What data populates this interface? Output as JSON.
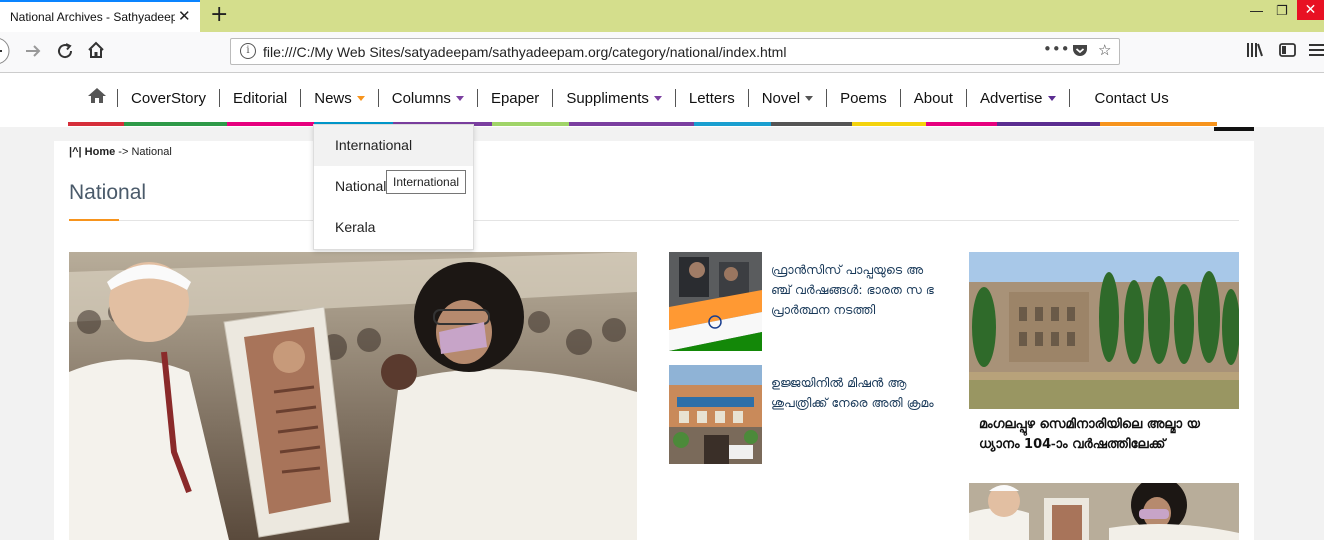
{
  "browser": {
    "tab_title": "National Archives - Sathyadeep",
    "tab_close": "✕",
    "new_tab": "+",
    "url": "file:///C:/My Web Sites/satyadeepam/sathyadeepam.org/category/national/index.html",
    "page_actions": "•••"
  },
  "menu": {
    "items": [
      "CoverStory",
      "Editorial",
      "News",
      "Columns",
      "Epaper",
      "Suppliments",
      "Letters",
      "Novel",
      "Poems",
      "About",
      "Advertise",
      "Contact Us"
    ],
    "caret_colors": {
      "News": "#f7941d",
      "Columns": "#7b3fa0",
      "Novel": "#555555",
      "Advertise": "#5b2d91"
    }
  },
  "colorbar": [
    "#d62e3a",
    "#2e9a48",
    "#e6007e",
    "#0099cc",
    "#f7941d",
    "#a0d468",
    "#7b3fa0",
    "#1a9fd0",
    "#555555",
    "#f4d30d",
    "#e6007e",
    "#f7941d",
    "#333333"
  ],
  "dropdown": {
    "items": [
      "International",
      "National",
      "Kerala"
    ],
    "tooltip": "International"
  },
  "breadcrumb": {
    "toggle": "|^|",
    "home": "Home",
    "arrow": "->",
    "current": "National"
  },
  "page": {
    "title": "National"
  },
  "stories": [
    {
      "title": "ഫ്രാന്‍സിസ് പാപ്പയുടെ അ ഞ്ച് വര്‍ഷങ്ങള്‍: ഭാരത സ ഭ പ്രാര്‍ത്ഥന നടത്തി"
    },
    {
      "title": "ഉജ്ജയിനില്‍ മിഷന്‍ ആ ശുപത്രിക്ക് നേരെ അതി ക്രമം"
    }
  ],
  "side_story": {
    "title": "മംഗലപ്പുഴ സെമിനാരിയിലെ അല്മാ യ ധ്യാനം 104-ാം വര്‍ഷത്തിലേക്ക്"
  }
}
